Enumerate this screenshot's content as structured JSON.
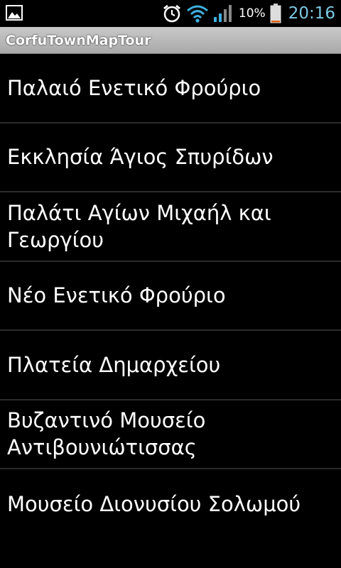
{
  "status_bar": {
    "icons": [
      "gallery-icon",
      "alarm-icon",
      "wifi-icon",
      "signal-icon",
      "battery-icon"
    ],
    "battery_percent": "10%",
    "battery_level": 0.1,
    "time": "20:16",
    "colors": {
      "time": "#7ec8e3",
      "wifi": "#3fb0e0",
      "battery_low": "#e06010"
    }
  },
  "app": {
    "title": "CorfuTownMapTour",
    "titlebar_color": "#b9b9b9"
  },
  "list": {
    "items": [
      {
        "label": "Παλαιό Ενετικό Φρούριο"
      },
      {
        "label": "Εκκλησία Άγιος Σπυρίδων"
      },
      {
        "label": "Παλάτι Αγίων Μιχαήλ και Γεωργίου"
      },
      {
        "label": "Νέο Ενετικό Φρούριο"
      },
      {
        "label": "Πλατεία Δημαρχείου"
      },
      {
        "label": "Βυζαντινό Μουσείο Αντιβουνιώτισσας"
      },
      {
        "label": "Μουσείο Διονυσίου Σολωμού"
      }
    ]
  }
}
